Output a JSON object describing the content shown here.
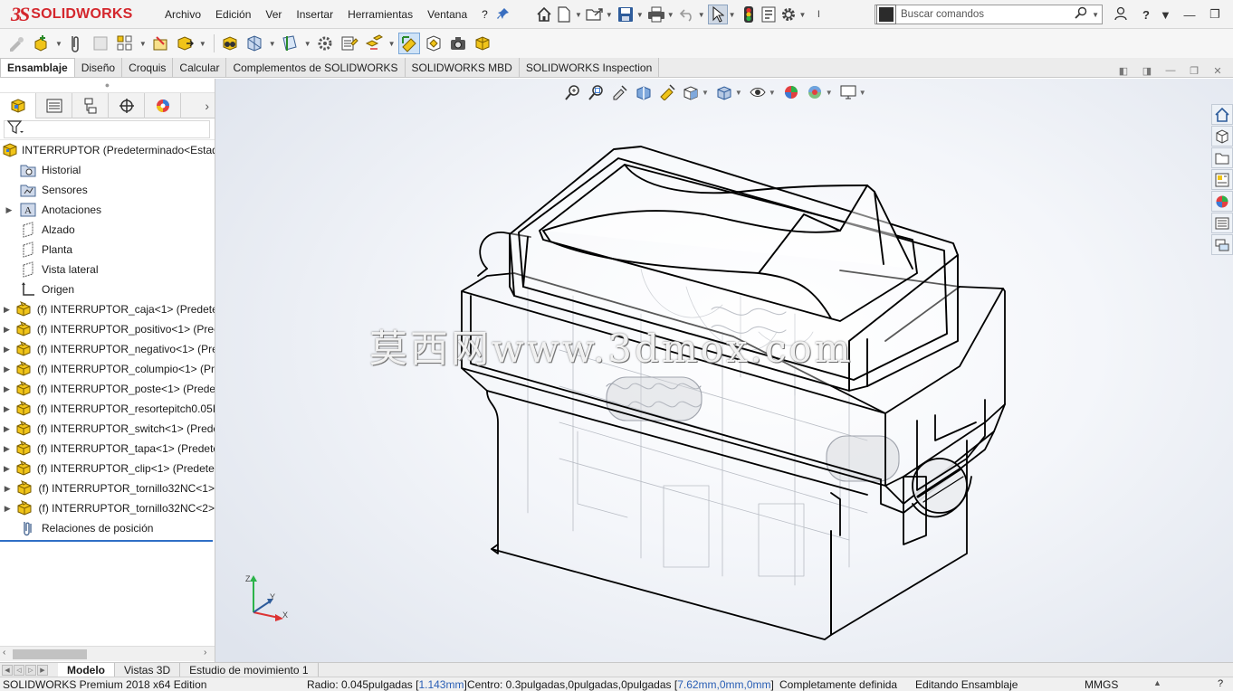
{
  "app": {
    "logo_mark": "3S",
    "logo_text": "SOLIDWORKS"
  },
  "menu": [
    "Archivo",
    "Edición",
    "Ver",
    "Insertar",
    "Herramientas",
    "Ventana",
    "?"
  ],
  "search": {
    "placeholder": "Buscar comandos"
  },
  "tabs": [
    "Ensamblaje",
    "Diseño",
    "Croquis",
    "Calcular",
    "Complementos de SOLIDWORKS",
    "SOLIDWORKS MBD",
    "SOLIDWORKS Inspection"
  ],
  "feature_tree": {
    "root": "INTERRUPTOR  (Predeterminado<Estado",
    "items": [
      {
        "label": "Historial",
        "icon": "history-folder-icon"
      },
      {
        "label": "Sensores",
        "icon": "sensor-icon"
      },
      {
        "label": "Anotaciones",
        "icon": "annotations-icon"
      },
      {
        "label": "Alzado",
        "icon": "plane-icon"
      },
      {
        "label": "Planta",
        "icon": "plane-icon"
      },
      {
        "label": "Vista lateral",
        "icon": "plane-icon"
      },
      {
        "label": "Origen",
        "icon": "origin-icon"
      },
      {
        "label": "(f) INTERRUPTOR_caja<1> (Predeter",
        "icon": "part-icon"
      },
      {
        "label": "(f) INTERRUPTOR_positivo<1> (Prec",
        "icon": "part-icon"
      },
      {
        "label": "(f) INTERRUPTOR_negativo<1> (Pre",
        "icon": "part-icon"
      },
      {
        "label": "(f) INTERRUPTOR_columpio<1> (Pr",
        "icon": "part-icon"
      },
      {
        "label": "(f) INTERRUPTOR_poste<1> (Predet",
        "icon": "part-icon"
      },
      {
        "label": "(f) INTERRUPTOR_resortepitch0.05IN",
        "icon": "part-icon"
      },
      {
        "label": "(f) INTERRUPTOR_switch<1> (Prede",
        "icon": "part-icon"
      },
      {
        "label": "(f) INTERRUPTOR_tapa<1> (Predete",
        "icon": "part-icon"
      },
      {
        "label": "(f) INTERRUPTOR_clip<1> (Predeter",
        "icon": "part-icon"
      },
      {
        "label": "(f) INTERRUPTOR_tornillo32NC<1>",
        "icon": "part-icon"
      },
      {
        "label": "(f) INTERRUPTOR_tornillo32NC<2>",
        "icon": "part-icon"
      },
      {
        "label": "Relaciones de posición",
        "icon": "mates-icon"
      }
    ]
  },
  "graphics": {
    "watermark": "莫西网www.3dmox.com",
    "triad": {
      "x": "X",
      "y": "Y",
      "z": "Z"
    }
  },
  "bottom_tabs": [
    "Modelo",
    "Vistas 3D",
    "Estudio de movimiento 1"
  ],
  "status": {
    "edition": "SOLIDWORKS Premium 2018 x64 Edition",
    "radius_prefix": "Radio: 0.045pulgadas [",
    "radius_metric": "1.143mm",
    "radius_suffix": "]",
    "center_prefix": "Centro: 0.3pulgadas,0pulgadas,0pulgadas [",
    "center_metric": "7.62mm,0mm,0mm",
    "center_suffix": "]",
    "definition": "Completamente definida",
    "mode": "Editando Ensamblaje",
    "units": "MMGS"
  },
  "colors": {
    "brand": "#d4262c",
    "part_yellow": "#f0c419",
    "accent_blue": "#2f6fc6"
  }
}
